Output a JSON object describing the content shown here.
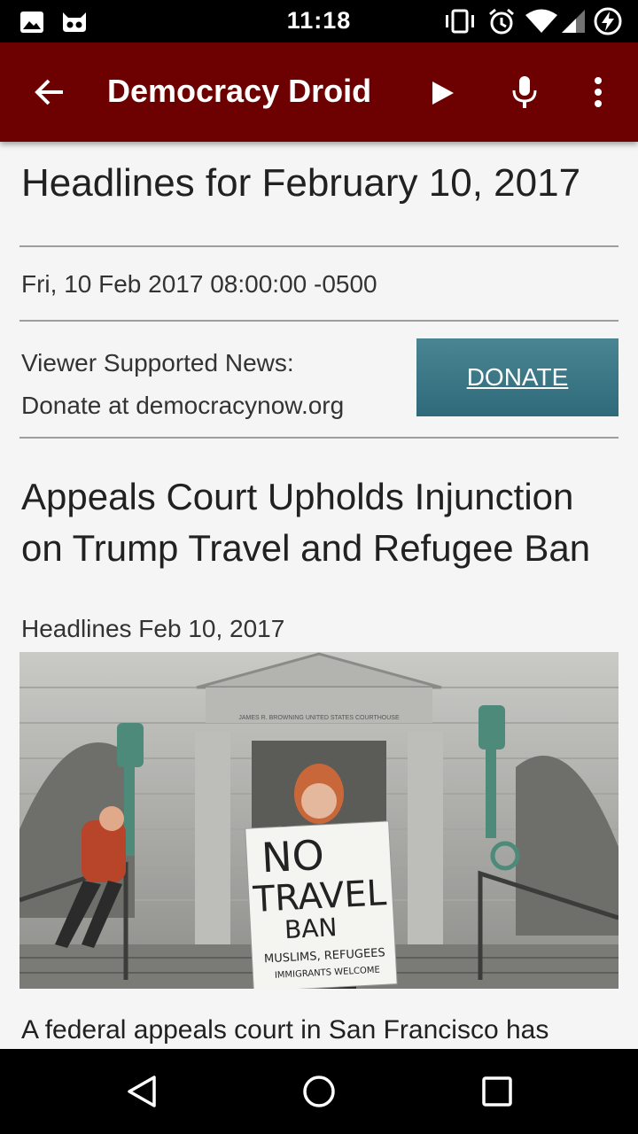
{
  "status_bar": {
    "time": "11:18",
    "left_icons": [
      "image-icon",
      "cat-icon"
    ],
    "right_icons": [
      "vibrate-icon",
      "alarm-icon",
      "wifi-icon",
      "signal-icon",
      "battery-charging-icon"
    ]
  },
  "app_bar": {
    "title": "Democracy Droid",
    "back_icon": "arrow-left-icon",
    "actions": [
      "play-icon",
      "mic-icon",
      "more-vert-icon"
    ],
    "background": "#6d0000"
  },
  "content": {
    "headline_title": "Headlines for February 10, 2017",
    "date": "Fri, 10 Feb 2017 08:00:00 -0500",
    "viewer_line1": "Viewer Supported News:",
    "viewer_line2": "Donate at democracynow.org",
    "donate_label": "DONATE",
    "donate_color": "#3c7886",
    "story_title": "Appeals Court Upholds Injunction on Trump Travel and Refugee Ban",
    "story_sub": "Headlines Feb 10, 2017",
    "photo": {
      "building_sign": "JAMES R. BROWNING UNITED STATES COURTHOUSE",
      "sign_line1": "NO",
      "sign_line2": "TRAVEL",
      "sign_line3": "BAN",
      "sign_line4": "MUSLIMS, REFUGEES",
      "sign_line5": "IMMIGRANTS WELCOME"
    },
    "story_body": "A federal appeals court in San Francisco has"
  },
  "nav_bar": {
    "buttons": [
      "back-triangle-icon",
      "home-circle-icon",
      "recents-square-icon"
    ]
  }
}
